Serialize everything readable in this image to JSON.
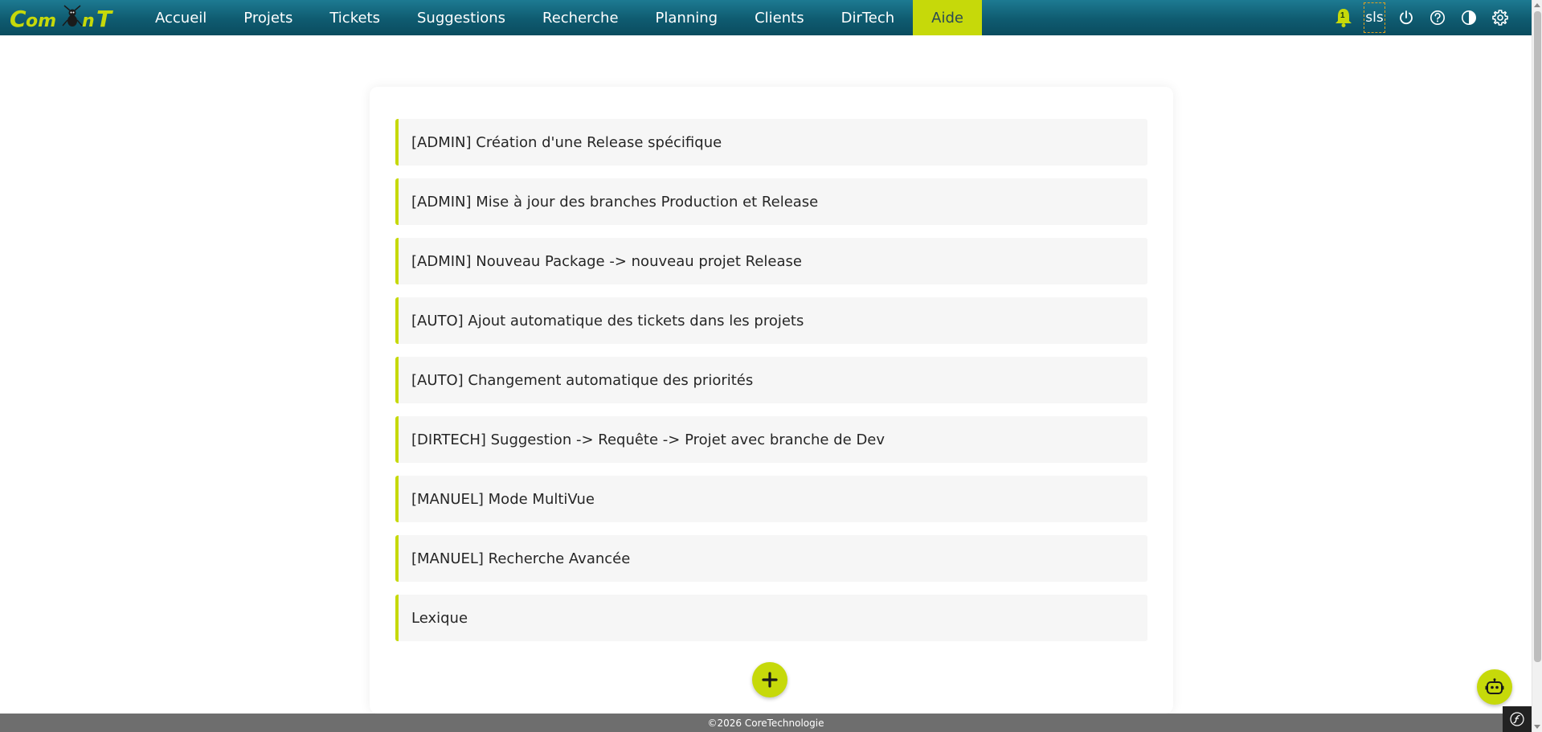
{
  "app": {
    "logo_text": "ComAnT"
  },
  "nav": {
    "items": [
      {
        "label": "Accueil"
      },
      {
        "label": "Projets"
      },
      {
        "label": "Tickets"
      },
      {
        "label": "Suggestions"
      },
      {
        "label": "Recherche"
      },
      {
        "label": "Planning"
      },
      {
        "label": "Clients"
      },
      {
        "label": "DirTech"
      },
      {
        "label": "Aide",
        "active": true
      }
    ]
  },
  "header_icons": {
    "notifications_count": "1",
    "user_initials": "sls",
    "icons": [
      "bell-icon",
      "power-icon",
      "help-icon",
      "contrast-icon",
      "gear-icon"
    ]
  },
  "help_pages": [
    {
      "label": "[ADMIN] Création d'une Release spécifique"
    },
    {
      "label": "[ADMIN] Mise à jour des branches Production et Release"
    },
    {
      "label": "[ADMIN] Nouveau Package -> nouveau projet Release"
    },
    {
      "label": "[AUTO] Ajout automatique des tickets dans les projets"
    },
    {
      "label": "[AUTO] Changement automatique des priorités"
    },
    {
      "label": "[DIRTECH] Suggestion -> Requête -> Projet avec branche de Dev"
    },
    {
      "label": "[MANUEL] Mode MultiVue"
    },
    {
      "label": "[MANUEL] Recherche Avancée"
    },
    {
      "label": "Lexique"
    }
  ],
  "footer": {
    "copyright": "©2026 CoreTechnologie"
  },
  "colors": {
    "accent": "#c6d90a",
    "header": "#0f5b70",
    "footer": "#6e6e6e",
    "item_bg": "#f6f6f6"
  }
}
